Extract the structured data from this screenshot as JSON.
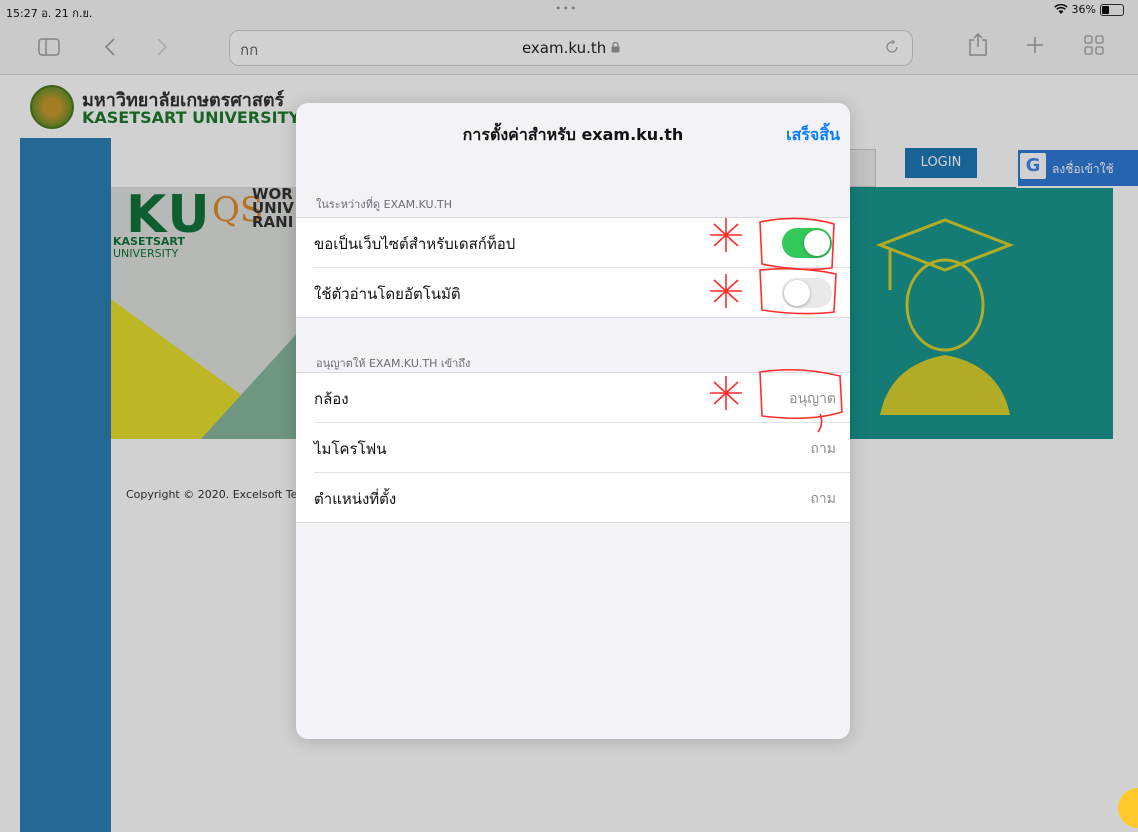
{
  "status": {
    "time_date": "15:27  อ. 21 ก.ย.",
    "dots": "•••",
    "battery": "36%"
  },
  "toolbar": {
    "aa_label": "กก",
    "domain": "exam.ku.th",
    "lock_glyph": "🔒"
  },
  "site": {
    "name_th": "มหาวิทยาลัยเกษตรศาสตร์",
    "name_en": "KASETSART UNIVERSITY",
    "ku_logo": "KU",
    "qs_logo": "QS",
    "qs_text": [
      "WOR",
      "UNIV",
      "RANI"
    ],
    "ks_small": "KASETSART",
    "ks_small2": "UNIVERSITY",
    "login_label": "LOGIN",
    "google_label": "ลงชื่อเข้าใช้",
    "copyright": "Copyright © 2020. Excelsoft Te"
  },
  "sheet": {
    "title": "การตั้งค่าสำหรับ exam.ku.th",
    "done": "เสร็จสิ้น",
    "section1_header": "ในระหว่างที่ดู EXAM.KU.TH",
    "desktop_site_label": "ขอเป็นเว็บไซต์สำหรับเดสก์ท็อป",
    "desktop_site_on": true,
    "reader_label": "ใช้ตัวอ่านโดยอัตโนมัติ",
    "reader_on": false,
    "section2_header": "อนุญาตให้ EXAM.KU.TH เข้าถึง",
    "camera_label": "กล้อง",
    "camera_value": "อนุญาต",
    "mic_label": "ไมโครโฟน",
    "mic_value": "ถาม",
    "location_label": "ตำแหน่งที่ตั้ง",
    "location_value": "ถาม"
  },
  "colors": {
    "toggle_on": "#34c759",
    "accent": "#0a7cff",
    "annotation": "#ff2d2d"
  }
}
